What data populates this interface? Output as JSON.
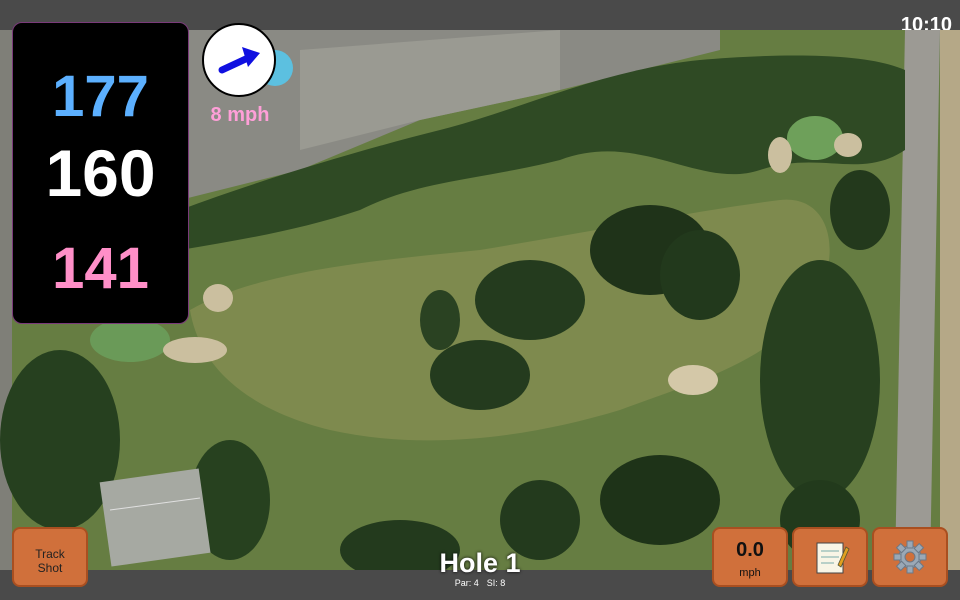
{
  "status": {
    "time": "10:10"
  },
  "yardage": {
    "back": "177",
    "middle": "160",
    "front": "141"
  },
  "wind": {
    "speed": "8 mph",
    "icon": "wind-direction-arrow-icon"
  },
  "hole": {
    "title": "Hole 1",
    "par": "Par: 4",
    "si": "SI: 8"
  },
  "buttons": {
    "track_shot_line1": "Track",
    "track_shot_line2": "Shot",
    "speed_value": "0.0",
    "speed_unit": "mph",
    "notes_icon": "notepad-icon",
    "settings_icon": "gear-icon"
  },
  "colors": {
    "back": "#5cb0ff",
    "middle": "#ffffff",
    "front": "#ff8fc8",
    "button": "#d0703b",
    "wind_arrow": "#1010e0"
  }
}
